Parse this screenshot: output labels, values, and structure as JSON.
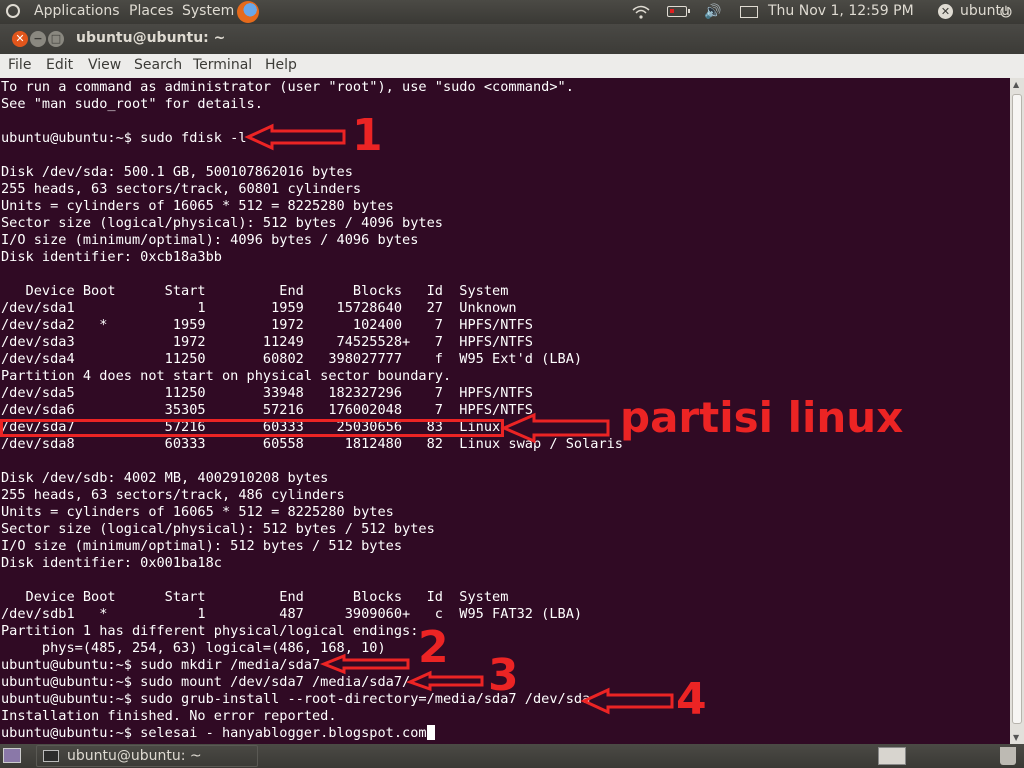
{
  "top_panel": {
    "menus": [
      "Applications",
      "Places",
      "System"
    ],
    "clock": "Thu Nov 1, 12:59 PM",
    "user": "ubuntu",
    "icons": [
      "ubuntu-logo-icon",
      "firefox-icon",
      "wifi-icon",
      "battery-icon",
      "volume-icon",
      "mail-icon",
      "user-icon",
      "power-icon"
    ]
  },
  "window": {
    "title": "ubuntu@ubuntu: ~",
    "menu": [
      "File",
      "Edit",
      "View",
      "Search",
      "Terminal",
      "Help"
    ]
  },
  "terminal": {
    "lines": [
      "To run a command as administrator (user \"root\"), use \"sudo <command>\".",
      "See \"man sudo_root\" for details.",
      "",
      "ubuntu@ubuntu:~$ sudo fdisk -l",
      "",
      "Disk /dev/sda: 500.1 GB, 500107862016 bytes",
      "255 heads, 63 sectors/track, 60801 cylinders",
      "Units = cylinders of 16065 * 512 = 8225280 bytes",
      "Sector size (logical/physical): 512 bytes / 4096 bytes",
      "I/O size (minimum/optimal): 4096 bytes / 4096 bytes",
      "Disk identifier: 0xcb18a3bb",
      "",
      "   Device Boot      Start         End      Blocks   Id  System",
      "/dev/sda1               1        1959    15728640   27  Unknown",
      "/dev/sda2   *        1959        1972      102400    7  HPFS/NTFS",
      "/dev/sda3            1972       11249    74525528+   7  HPFS/NTFS",
      "/dev/sda4           11250       60802   398027777    f  W95 Ext'd (LBA)",
      "Partition 4 does not start on physical sector boundary.",
      "/dev/sda5           11250       33948   182327296    7  HPFS/NTFS",
      "/dev/sda6           35305       57216   176002048    7  HPFS/NTFS",
      "/dev/sda7           57216       60333    25030656   83  Linux",
      "/dev/sda8           60333       60558     1812480   82  Linux swap / Solaris",
      "",
      "Disk /dev/sdb: 4002 MB, 4002910208 bytes",
      "255 heads, 63 sectors/track, 486 cylinders",
      "Units = cylinders of 16065 * 512 = 8225280 bytes",
      "Sector size (logical/physical): 512 bytes / 512 bytes",
      "I/O size (minimum/optimal): 512 bytes / 512 bytes",
      "Disk identifier: 0x001ba18c",
      "",
      "   Device Boot      Start         End      Blocks   Id  System",
      "/dev/sdb1   *           1         487     3909060+   c  W95 FAT32 (LBA)",
      "Partition 1 has different physical/logical endings:",
      "     phys=(485, 254, 63) logical=(486, 168, 10)",
      "ubuntu@ubuntu:~$ sudo mkdir /media/sda7",
      "ubuntu@ubuntu:~$ sudo mount /dev/sda7 /media/sda7/",
      "ubuntu@ubuntu:~$ sudo grub-install --root-directory=/media/sda7 /dev/sda",
      "Installation finished. No error reported.",
      "ubuntu@ubuntu:~$ selesai - hanyablogger.blogspot.com"
    ]
  },
  "annotations": {
    "step1": "1",
    "step2": "2",
    "step3": "3",
    "step4": "4",
    "label": "partisi linux",
    "color": "#ec2424"
  },
  "bottom_panel": {
    "task_label": "ubuntu@ubuntu: ~"
  }
}
